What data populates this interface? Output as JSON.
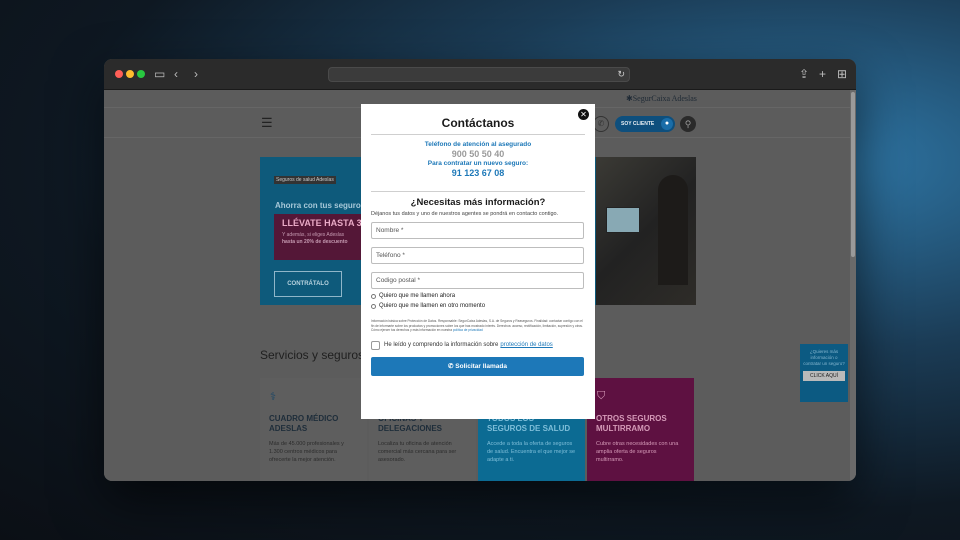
{
  "browser": {
    "url": "",
    "icons": [
      "sidebar-icon",
      "back-icon",
      "forward-icon",
      "share-icon",
      "new-tab-icon",
      "tab-overview-icon"
    ]
  },
  "site": {
    "logo": "✱SegurCaixa Adeslas",
    "client_button": "SOY CLIENTE"
  },
  "hero": {
    "badge": "Seguros de salud Adeslas",
    "intro": "Ahorra con tus seguro",
    "promo_big": "LLÉVATE HASTA 3",
    "promo_small1": "Y además, si eliges Adeslas",
    "promo_small2": "hasta un 20% de descuento",
    "cta": "CONTRÁTALO"
  },
  "services": {
    "title": "Servicios y seguros",
    "cards": [
      {
        "title": "CUADRO MÉDICO ADESLAS",
        "desc": "Más de 45.000 profesionales y 1.300 centros médicos para ofrecerte la mejor atención."
      },
      {
        "title": "OFICINAS Y DELEGACIONES",
        "desc": "Localiza tu oficina de atención comercial más cercana para ser asesorado."
      },
      {
        "title": "TODOS LOS SEGUROS DE SALUD",
        "desc": "Accede a toda la oferta de seguros de salud. Encuentra el que mejor se adapte a ti."
      },
      {
        "title": "OTROS SEGUROS MULTIRRAMO",
        "desc": "Cubre otras necesidades con una amplia oferta de seguros multirramo."
      }
    ]
  },
  "side_widget": {
    "text": "¿Quieres más información o contratar un seguro?",
    "button": "CLICK AQUÍ"
  },
  "modal": {
    "title": "Contáctanos",
    "label_insured": "Teléfono de atención al asegurado",
    "phone_insured": "900 50 50 40",
    "label_contract": "Para contratar un nuevo seguro:",
    "phone_contract": "91 123 67 08",
    "subtitle": "¿Necesitas más información?",
    "intro": "Déjanos tus datos y uno de nuestros agentes se pondrá en contacto contigo.",
    "name_placeholder": "Nombre *",
    "phone_placeholder": "Teléfono *",
    "zip_placeholder": "Codigo postal *",
    "radio_now": "Quiero que me llamen ahora",
    "radio_later": "Quiero que me llamen en otro momento",
    "legal_text": "Información básica sobre Protección de Datos. Responsable: SegurCaixa Adeslas, S.A. de Seguros y Reaseguros. Finalidad: contactar contigo con el fin de informarte sobre los productos y promociones sobre los que has mostrado interés. Derechos: acceso, rectificación, limitación, supresión y otros. Cómo ejercer tus derechos y más información en nuestra",
    "legal_link": "política de privacidad",
    "consent_text": "He leído y comprendo la información sobre",
    "consent_link": "protección de datos",
    "submit": "Solicitar llamada"
  }
}
